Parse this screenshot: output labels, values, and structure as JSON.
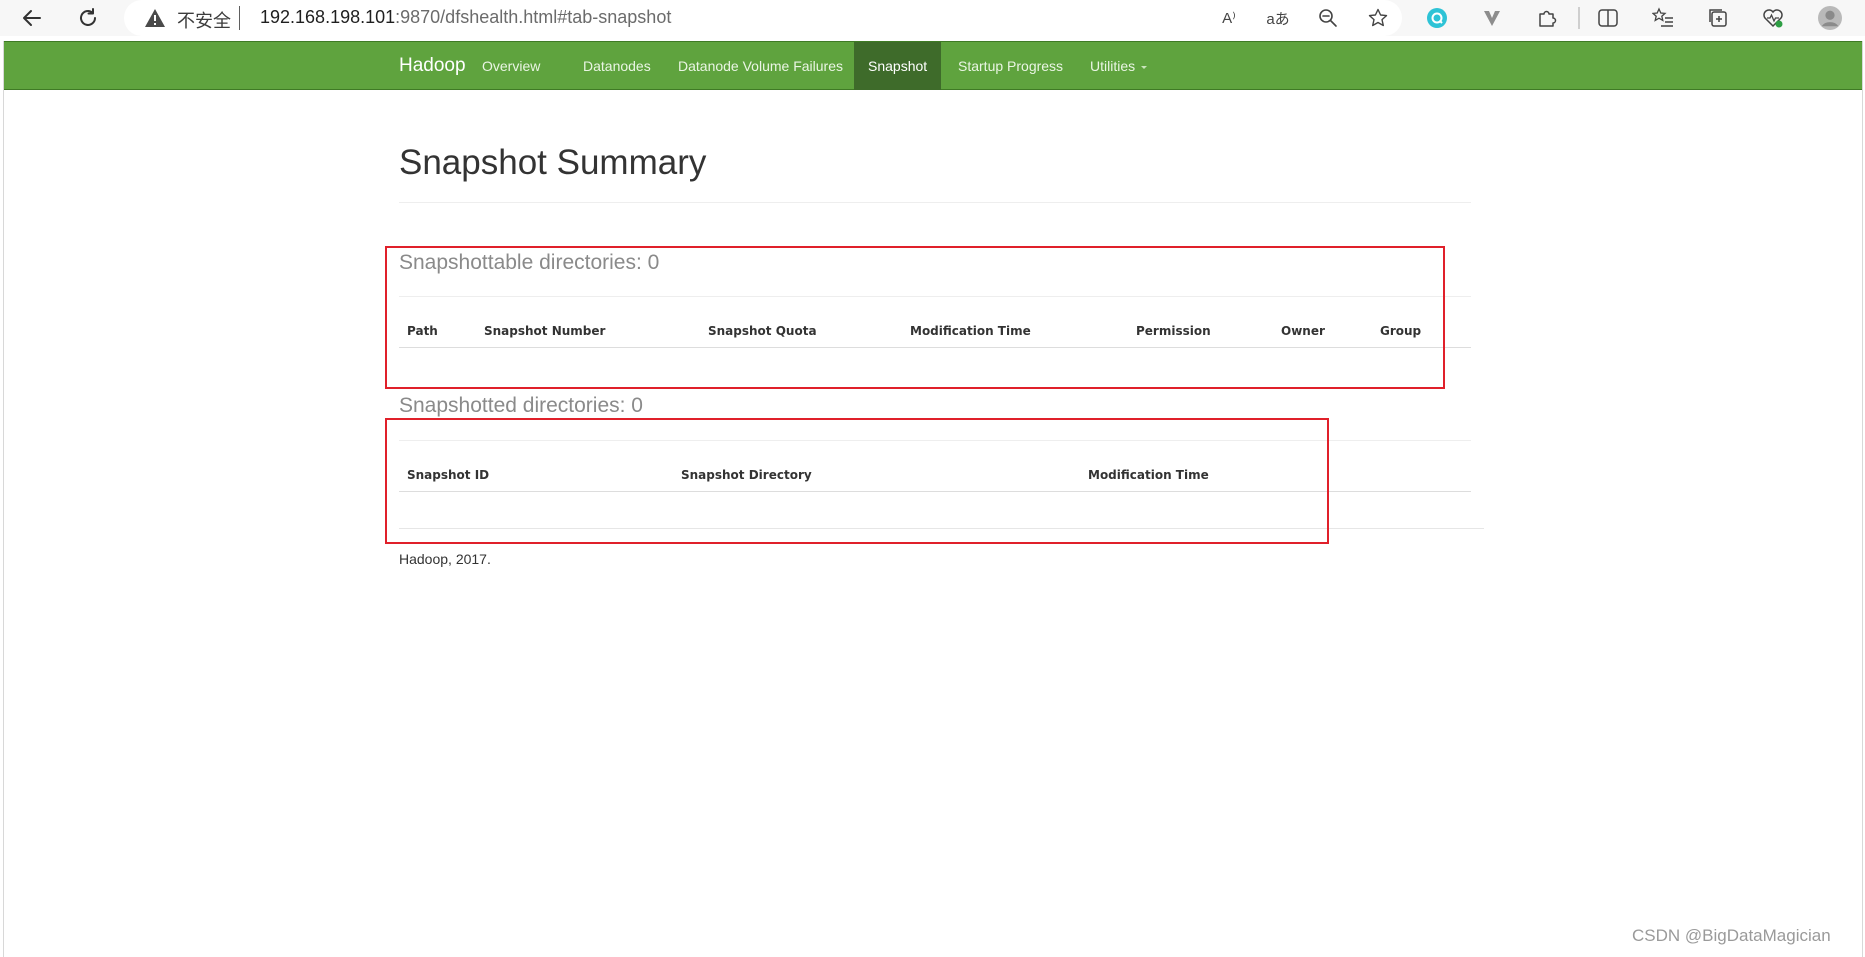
{
  "browser": {
    "insecure_label": "不安全",
    "url_host": "192.168.198.101",
    "url_path": ":9870/dfshealth.html#tab-snapshot",
    "read_aloud_label": "A⁾",
    "translate_label": "aあ"
  },
  "navbar": {
    "brand": "Hadoop",
    "items": [
      {
        "label": "Overview"
      },
      {
        "label": "Datanodes"
      },
      {
        "label": "Datanode Volume Failures"
      },
      {
        "label": "Snapshot"
      },
      {
        "label": "Startup Progress"
      },
      {
        "label": "Utilities"
      }
    ],
    "active_index": 3
  },
  "page": {
    "title": "Snapshot Summary"
  },
  "snapshottable": {
    "heading": "Snapshottable directories: 0",
    "columns": [
      "Path",
      "Snapshot Number",
      "Snapshot Quota",
      "Modification Time",
      "Permission",
      "Owner",
      "Group"
    ]
  },
  "snapshotted": {
    "heading": "Snapshotted directories: 0",
    "columns": [
      "Snapshot ID",
      "Snapshot Directory",
      "Modification Time"
    ]
  },
  "footer": {
    "text": "Hadoop, 2017."
  },
  "watermark": "CSDN @BigDataMagician",
  "colors": {
    "navbar": "#5fa33e",
    "navbar_active": "#3e6b2a",
    "highlight": "#e0202a"
  }
}
